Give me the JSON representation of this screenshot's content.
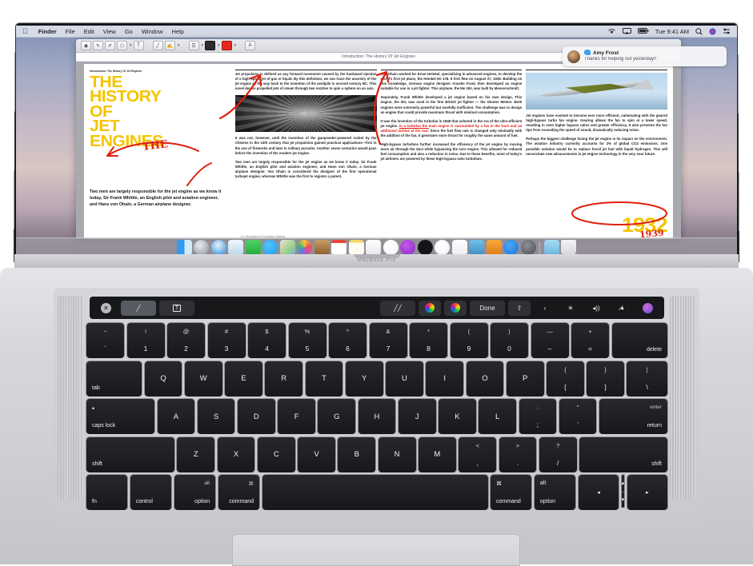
{
  "device": {
    "brand": "MacBook Pro"
  },
  "menubar": {
    "apple_icon": "apple-icon",
    "items": [
      "Finder",
      "File",
      "Edit",
      "View",
      "Go",
      "Window",
      "Help"
    ],
    "status": {
      "wifi_icon": "wifi-icon",
      "airplay_icon": "airplay-icon",
      "battery_icon": "battery-icon",
      "clock": "Tue 9:41 AM",
      "search_icon": "search-icon",
      "siri_icon": "siri-icon",
      "control_center_icon": "control-center-icon"
    }
  },
  "notification": {
    "app_icon": "messages-icon",
    "sender": "Amy Frost",
    "message": "Thanks for helping out yesterday!!"
  },
  "app_window": {
    "document_title": "Introduction: The History Of Jet Engines",
    "toolbar": [
      {
        "name": "view-icon",
        "glyph": "◉"
      },
      {
        "name": "markup-pen-icon",
        "glyph": "✎"
      },
      {
        "name": "brush-icon",
        "glyph": "✐"
      },
      {
        "name": "shapes-icon",
        "glyph": "⬠"
      },
      {
        "name": "text-box-icon",
        "glyph": "T"
      },
      {
        "name": "pencil-icon",
        "glyph": "╱"
      },
      {
        "name": "sign-icon",
        "glyph": "✍"
      },
      {
        "name": "line-style-icon",
        "glyph": "☰"
      },
      {
        "name": "border-color-icon",
        "glyph": "▬"
      },
      {
        "name": "fill-color-swatch",
        "glyph": ""
      },
      {
        "name": "font-icon",
        "glyph": "A"
      }
    ]
  },
  "document": {
    "kicker": "Introduction:  The History Of Jet Engines",
    "headline": {
      "l1": "THE",
      "l2": "HISTORY",
      "l3": "OF",
      "l4": "JET",
      "l5": "ENGINES"
    },
    "annotations": {
      "inserted_word": "THE",
      "year_printed": "1932",
      "year_correction": "1939"
    },
    "lede": "Two men are largely responsible for the jet engine as we know it today, Sir Frank Whittle, an English pilot and aviation engineer, and Hans von Ohain, a German airplane designer.",
    "col2_p1": "Jet propulsion is defined as any forward movement caused by the backward ejection of a high-speed jet of gas or liquid. By this definition, we can trace the ancestry of the jet engine all the way back to the invention of the aeolipile in second century BC. This novel device propelled jets of steam through two nozzles to spin a sphere on an axis.",
    "col2_p2": "It was not, however, until the invention of the gunpowder-powered rocket by the Chinese in the 13th century that jet propulsion gained practical applications—first in the use of fireworks and later in military pursuits. Another seven centuries would pass before the invention of the modern jet engine.",
    "col2_p3": "Two men are largely responsible for the jet engine as we know it today. Sir Frank Whittle, an English pilot and aviation engineer, and Hans von Ohain, a German airplane designer. Von Ohain is considered the designer of the first operational turbojet engine, whereas Whittle was the first to register a patent.",
    "col3_p1": "Von Ohain worked for Ernst Heinkel, specializing in advanced engines, to develop the world's first jet plane, the Heinkel He 178. It first flew on August 27, 1939. Building on this knowledge, German engine designer Anselm Franz then developed an engine suitable for use in a jet fighter. This airplane, the Me 262, was built by Messerschmitt.",
    "col3_p2": "Separately, Frank Whittle developed a jet engine based on his own design. This engine, the W1, was used in the first British jet fighter — the Gloster Meteor. Both engines were extremely powerful but woefully inefficient. The challenge was to design an engine that could provide maximum thrust with minimal consumption.",
    "col3_p3_a": "It was the invention of the turbofan in 1948 that ushered in the era of the ultra-efficient jet engine.",
    "col3_p3_struck": "In a turbofan the main engine is surrounded by a fan in the front and an additional turbine at the rear.",
    "col3_p3_b": "Since the fuel flow rate is changed only minimally with the addition of the fan, it generates more thrust for roughly the same amount of fuel.",
    "col3_p4": "High-bypass turbofans further increased the efficiency of the jet engine by moving more air through the duct while bypassing the core engine. This allowed for reduced fuel consumption and also a reduction in noise. Due to these benefits, most of today's jet airliners are powered by these high-bypass-ratio turbofans.",
    "col4_p1": "Jet engines have evolved to become ever more efficient, culminating with the geared high-bypass turbo fan engine. Gearing allows the fan to spin at a lower speed, resulting in even higher bypass ratios and greater efficiency. It also prevents the fan tips from exceeding the speed of sound, dramatically reducing noise.",
    "col4_p2": "Perhaps the biggest challenge facing the jet engine is its impact on the environment. The aviation industry currently accounts for 2% of global CO2 emissions. One possible solution would be to replace fossil jet fuel with liquid hydrogen. This will necessitate new advancements in jet engine technology in the very near future.",
    "footer": "14 | Introduction to Propulsion Systems",
    "image_turbine": "jet-turbine-photo",
    "image_plane": "jet-aircraft-photo"
  },
  "dock": {
    "items": [
      {
        "name": "finder-icon",
        "label": "Finder"
      },
      {
        "name": "launchpad-icon",
        "label": "Launchpad"
      },
      {
        "name": "safari-icon",
        "label": "Safari"
      },
      {
        "name": "mail-icon",
        "label": "Mail"
      },
      {
        "name": "facetime-icon",
        "label": "FaceTime"
      },
      {
        "name": "messages-icon",
        "label": "Messages"
      },
      {
        "name": "maps-icon",
        "label": "Maps"
      },
      {
        "name": "photos-icon",
        "label": "Photos"
      },
      {
        "name": "contacts-icon",
        "label": "Contacts"
      },
      {
        "name": "calendar-icon",
        "label": "Calendar"
      },
      {
        "name": "notes-icon",
        "label": "Notes"
      },
      {
        "name": "reminders-icon",
        "label": "Reminders"
      },
      {
        "name": "music-icon",
        "label": "Music"
      },
      {
        "name": "podcasts-icon",
        "label": "Podcasts"
      },
      {
        "name": "tv-icon",
        "label": "TV"
      },
      {
        "name": "news-icon",
        "label": "News"
      },
      {
        "name": "numbers-icon",
        "label": "Numbers"
      },
      {
        "name": "keynote-icon",
        "label": "Keynote"
      },
      {
        "name": "pages-icon",
        "label": "Pages"
      },
      {
        "name": "app-store-icon",
        "label": "App Store"
      },
      {
        "name": "system-preferences-icon",
        "label": "System Preferences"
      },
      {
        "name": "document-icon",
        "label": "Document"
      },
      {
        "name": "trash-icon",
        "label": "Trash"
      }
    ]
  },
  "touchbar": {
    "close_label": "✕",
    "items": [
      {
        "name": "markup-pen-button",
        "label": "╱",
        "selected": true
      },
      {
        "name": "text-tool-button",
        "label": "T",
        "selected": false
      },
      {
        "name": "line-style-button",
        "label": "╱╱",
        "selected": false
      },
      {
        "name": "color-wheel-button",
        "label": "",
        "selected": false
      },
      {
        "name": "stroke-color-button",
        "label": "",
        "selected": false
      }
    ],
    "done_label": "Done",
    "share_label": "⇧",
    "expand_label": "‹",
    "brightness_label": "☀",
    "volume_label": "◂))",
    "mute_label": "◂̸",
    "siri_label": ""
  },
  "keyboard": {
    "row1": [
      {
        "up": "~",
        "lo": "`"
      },
      {
        "up": "!",
        "lo": "1"
      },
      {
        "up": "@",
        "lo": "2"
      },
      {
        "up": "#",
        "lo": "3"
      },
      {
        "up": "$",
        "lo": "4"
      },
      {
        "up": "%",
        "lo": "5"
      },
      {
        "up": "^",
        "lo": "6"
      },
      {
        "up": "&",
        "lo": "7"
      },
      {
        "up": "*",
        "lo": "8"
      },
      {
        "up": "(",
        "lo": "9"
      },
      {
        "up": ")",
        "lo": "0"
      },
      {
        "up": "—",
        "lo": "–"
      },
      {
        "up": "+",
        "lo": "="
      }
    ],
    "row1_end": "delete",
    "row2_start": "tab",
    "row2": [
      "Q",
      "W",
      "E",
      "R",
      "T",
      "Y",
      "U",
      "I",
      "O",
      "P"
    ],
    "row2_brackets": [
      {
        "up": "{",
        "lo": "["
      },
      {
        "up": "}",
        "lo": "]"
      },
      {
        "up": "|",
        "lo": "\\"
      }
    ],
    "row3_start": "caps lock",
    "row3": [
      "A",
      "S",
      "D",
      "F",
      "G",
      "H",
      "J",
      "K",
      "L"
    ],
    "row3_punct": [
      {
        "up": ":",
        "lo": ";"
      },
      {
        "up": "”",
        "lo": "’"
      }
    ],
    "row3_end_top": "enter",
    "row3_end_bottom": "return",
    "row4_start": "shift",
    "row4": [
      "Z",
      "X",
      "C",
      "V",
      "B",
      "N",
      "M"
    ],
    "row4_punct": [
      {
        "up": "<",
        "lo": ","
      },
      {
        "up": ">",
        "lo": "."
      },
      {
        "up": "?",
        "lo": "/"
      }
    ],
    "row4_end": "shift",
    "row5": [
      {
        "top": "",
        "bottom": "fn"
      },
      {
        "top": "",
        "bottom": "control"
      },
      {
        "top": "alt",
        "bottom": "option"
      },
      {
        "top": "⌘",
        "bottom": "command"
      },
      {
        "top": "",
        "bottom": ""
      },
      {
        "top": "⌘",
        "bottom": "command"
      },
      {
        "top": "alt",
        "bottom": "option"
      }
    ],
    "arrows": {
      "left": "◂",
      "up": "▴",
      "down": "▾",
      "right": "▸"
    }
  },
  "colors": {
    "headline_yellow": "#f5c400",
    "annotation_red": "#e02010",
    "touchbar_bg": "#17181a",
    "key_bg": "#1f2024"
  }
}
